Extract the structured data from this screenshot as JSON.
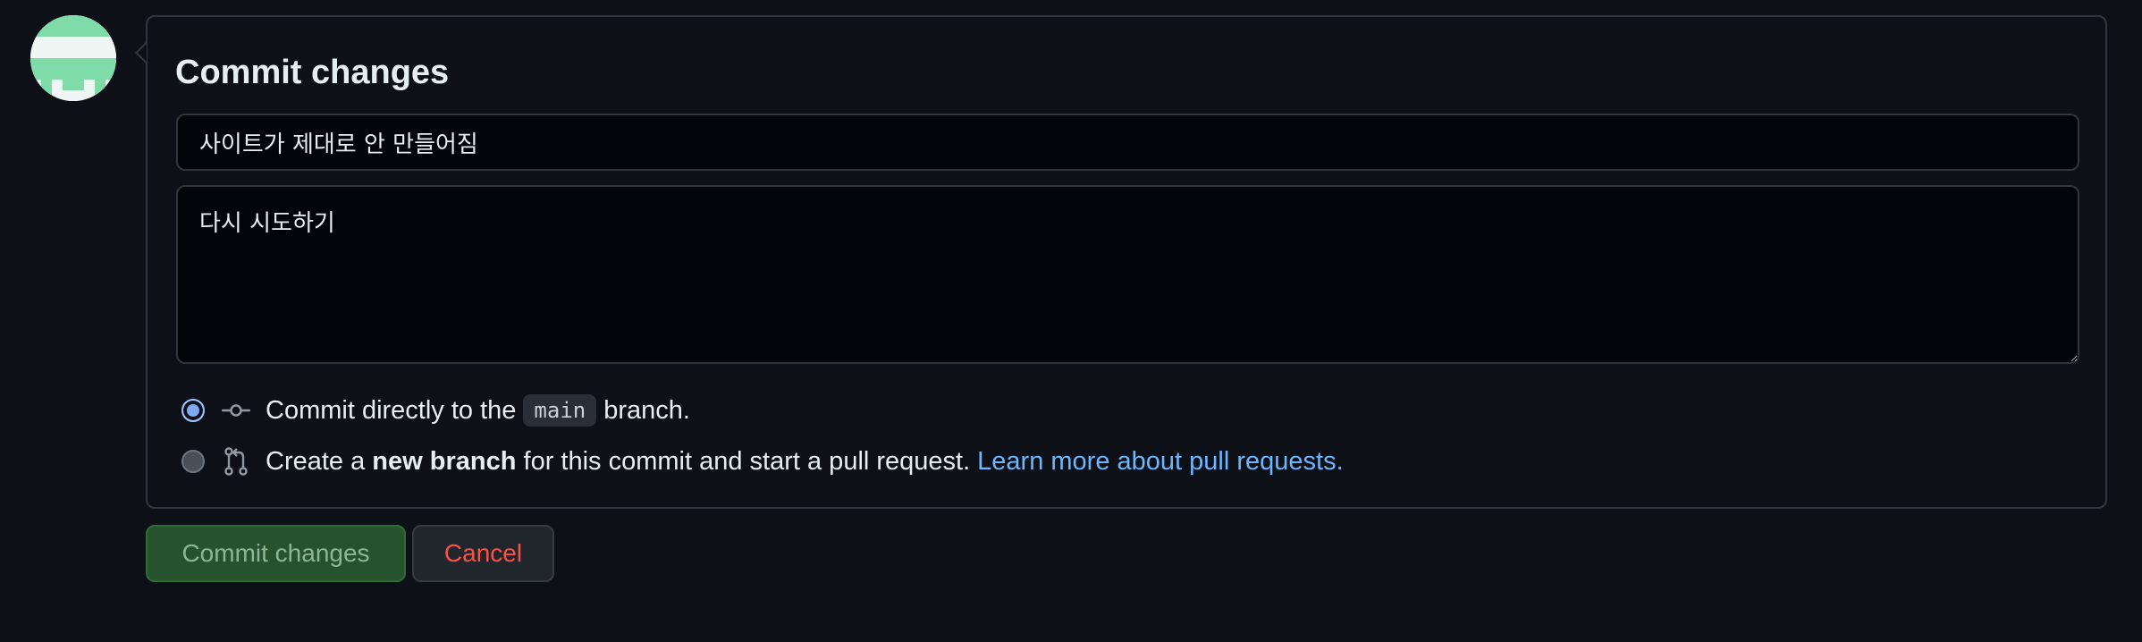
{
  "form": {
    "title": "Commit changes",
    "summary_value": "사이트가 제대로 안 만들어짐",
    "description_value": "다시 시도하기"
  },
  "options": {
    "direct": {
      "prefix": "Commit directly to the",
      "branch": "main",
      "suffix": "branch.",
      "icon": "git-commit-icon",
      "selected": true
    },
    "new_branch": {
      "prefix": "Create a",
      "bold": "new branch",
      "suffix": "for this commit and start a pull request.",
      "link": "Learn more about pull requests.",
      "icon": "git-pull-request-icon",
      "selected": false
    }
  },
  "buttons": {
    "commit_label": "Commit changes",
    "cancel_label": "Cancel"
  },
  "colors": {
    "background": "#0d1117",
    "link": "#6cb6ff",
    "commit_button": "#26532d",
    "cancel_text": "#f85149",
    "avatar_green": "#7fdca8"
  }
}
